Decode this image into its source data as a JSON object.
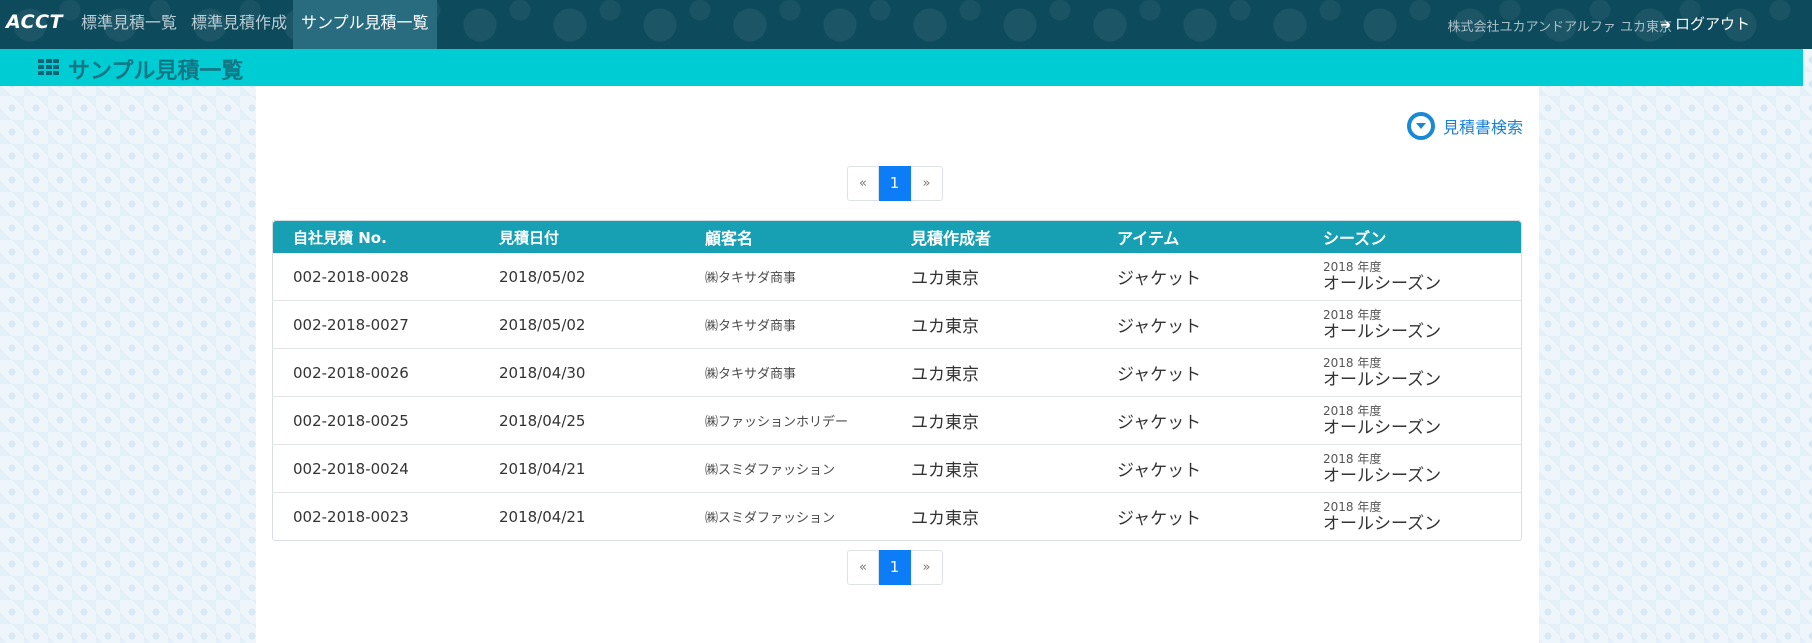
{
  "navbar": {
    "brand": "ACCT",
    "links": [
      {
        "label": "標準見積一覧"
      },
      {
        "label": "標準見積作成"
      },
      {
        "label": "サンプル見積一覧"
      }
    ],
    "company": "株式会社ユカアンドアルファ ユカ東京",
    "logout": "ログアウト"
  },
  "page": {
    "title": "サンプル見積一覧",
    "search_toggle": "見積書検索"
  },
  "pagination": {
    "prev": "«",
    "current": "1",
    "next": "»"
  },
  "table": {
    "headers": [
      "自社見積 No.",
      "見積日付",
      "顧客名",
      "見積作成者",
      "アイテム",
      "シーズン"
    ],
    "rows": [
      {
        "no": "002-2018-0028",
        "date": "2018/05/02",
        "customer": "㈱タキサダ商事",
        "author": "ユカ東京",
        "item": "ジャケット",
        "season_year": "2018 年度",
        "season": "オールシーズン"
      },
      {
        "no": "002-2018-0027",
        "date": "2018/05/02",
        "customer": "㈱タキサダ商事",
        "author": "ユカ東京",
        "item": "ジャケット",
        "season_year": "2018 年度",
        "season": "オールシーズン"
      },
      {
        "no": "002-2018-0026",
        "date": "2018/04/30",
        "customer": "㈱タキサダ商事",
        "author": "ユカ東京",
        "item": "ジャケット",
        "season_year": "2018 年度",
        "season": "オールシーズン"
      },
      {
        "no": "002-2018-0025",
        "date": "2018/04/25",
        "customer": "㈱ファッションホリデー",
        "author": "ユカ東京",
        "item": "ジャケット",
        "season_year": "2018 年度",
        "season": "オールシーズン"
      },
      {
        "no": "002-2018-0024",
        "date": "2018/04/21",
        "customer": "㈱スミダファッション",
        "author": "ユカ東京",
        "item": "ジャケット",
        "season_year": "2018 年度",
        "season": "オールシーズン"
      },
      {
        "no": "002-2018-0023",
        "date": "2018/04/21",
        "customer": "㈱スミダファッション",
        "author": "ユカ東京",
        "item": "ジャケット",
        "season_year": "2018 年度",
        "season": "オールシーズン"
      }
    ]
  },
  "colors": {
    "navbar": "#0d4a5c",
    "sub_header": "#00cdd3",
    "table_header": "#17a0b3",
    "page_active": "#0d7df7",
    "link": "#1a7fd1"
  }
}
